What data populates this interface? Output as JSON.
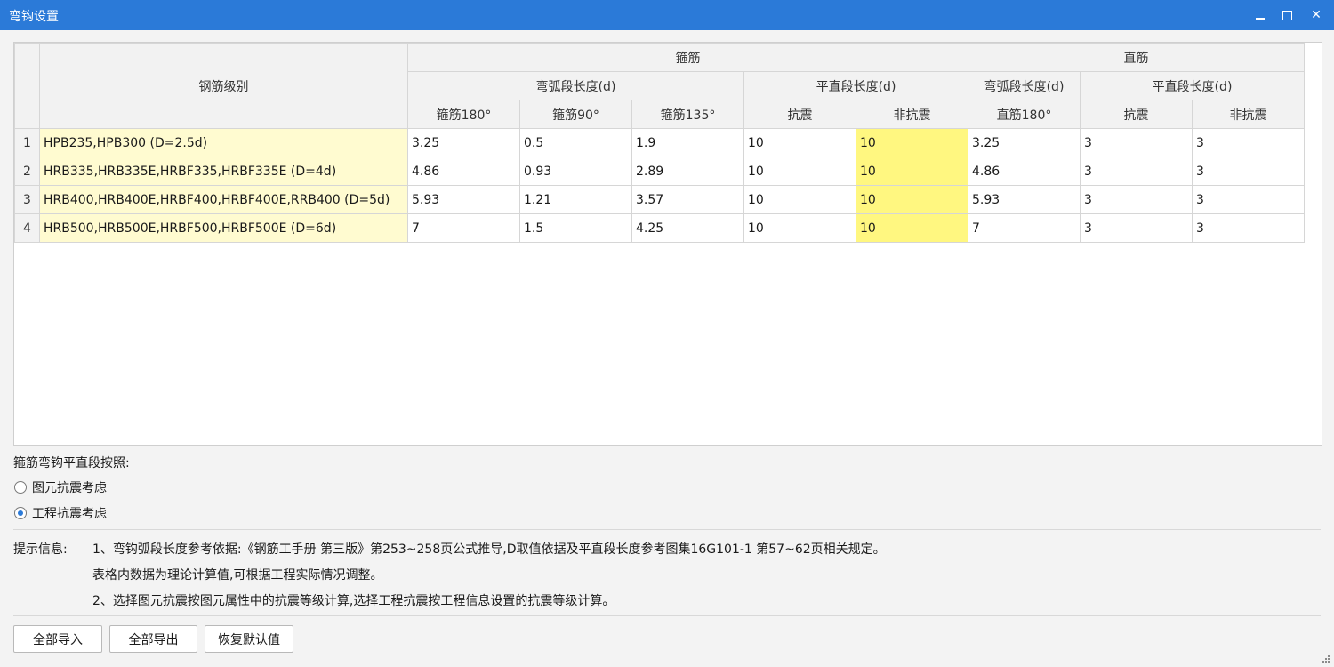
{
  "window": {
    "title": "弯钩设置",
    "min_icon": "minimize-icon",
    "max_icon": "maximize-icon",
    "close_icon": "close-icon",
    "close_glyph": "✕"
  },
  "grid": {
    "header": {
      "grade": "钢筋级别",
      "stirrup": "箍筋",
      "straight": "直筋",
      "stirrup_arc": "弯弧段长度(d)",
      "stirrup_flat": "平直段长度(d)",
      "straight_arc": "弯弧段长度(d)",
      "straight_flat": "平直段长度(d)",
      "c180": "箍筋180°",
      "c90": "箍筋90°",
      "c135": "箍筋135°",
      "seismic": "抗震",
      "nonseismic": "非抗震",
      "s180": "直筋180°",
      "s_seismic": "抗震",
      "s_nonseismic": "非抗震"
    },
    "rows": [
      {
        "num": "1",
        "grade": "HPB235,HPB300 (D=2.5d)",
        "c180": "3.25",
        "c90": "0.5",
        "c135": "1.9",
        "seis": "10",
        "nonseis": "10",
        "s180": "3.25",
        "s_seis": "3",
        "s_nonseis": "3"
      },
      {
        "num": "2",
        "grade": "HRB335,HRB335E,HRBF335,HRBF335E (D=4d)",
        "c180": "4.86",
        "c90": "0.93",
        "c135": "2.89",
        "seis": "10",
        "nonseis": "10",
        "s180": "4.86",
        "s_seis": "3",
        "s_nonseis": "3"
      },
      {
        "num": "3",
        "grade": "HRB400,HRB400E,HRBF400,HRBF400E,RRB400 (D=5d)",
        "c180": "5.93",
        "c90": "1.21",
        "c135": "3.57",
        "seis": "10",
        "nonseis": "10",
        "s180": "5.93",
        "s_seis": "3",
        "s_nonseis": "3"
      },
      {
        "num": "4",
        "grade": "HRB500,HRB500E,HRBF500,HRBF500E (D=6d)",
        "c180": "7",
        "c90": "1.5",
        "c135": "4.25",
        "seis": "10",
        "nonseis": "10",
        "s180": "7",
        "s_seis": "3",
        "s_nonseis": "3"
      }
    ]
  },
  "options": {
    "label": "箍筋弯钩平直段按照:",
    "radio1": "图元抗震考虑",
    "radio2": "工程抗震考虑",
    "selected": "工程抗震考虑"
  },
  "hints": {
    "label": "提示信息:",
    "line1": "1、弯钩弧段长度参考依据:《钢筋工手册 第三版》第253~258页公式推导,D取值依据及平直段长度参考图集16G101-1 第57~62页相关规定。",
    "line2": "表格内数据为理论计算值,可根据工程实际情况调整。",
    "line3": "2、选择图元抗震按图元属性中的抗震等级计算,选择工程抗震按工程信息设置的抗震等级计算。"
  },
  "buttons": {
    "import_all": "全部导入",
    "export_all": "全部导出",
    "restore_default": "恢复默认值"
  },
  "colors": {
    "titlebar": "#2b7ad8",
    "grade_bg": "#fffbd0",
    "highlight": "#fff780"
  }
}
